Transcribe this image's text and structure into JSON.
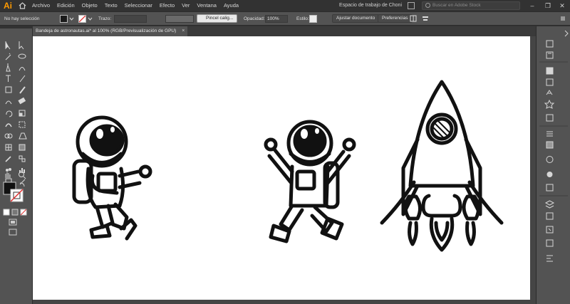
{
  "app": {
    "logo": "Ai",
    "menu": [
      "Archivo",
      "Edición",
      "Objeto",
      "Texto",
      "Seleccionar",
      "Efecto",
      "Ver",
      "Ventana",
      "Ayuda"
    ],
    "workspace_label": "Espacio de trabajo de Choni",
    "stock_search_placeholder": "Buscar en Adobe Stock",
    "window_controls": [
      "–",
      "❐",
      "✕"
    ]
  },
  "control_bar": {
    "selection_status": "No hay selección",
    "stroke_label": "Trazo:",
    "brush_label": "Pincel calig...",
    "opacity_label": "Opacidad:",
    "opacity_value": "100%",
    "style_label": "Estilo:",
    "document_setup_label": "Ajustar documento",
    "preferences_label": "Preferencias",
    "colors": {
      "fill": "#1a1a1a",
      "stroke": "#ffffff"
    }
  },
  "document": {
    "tab_title": "Bandeja de astronautas.ai* al 100% (RGB/Previsualización de GPU)",
    "tab_close": "×"
  },
  "artboard": {
    "objects": [
      "astronaut-floating",
      "astronaut-jumping",
      "rocket"
    ]
  },
  "icons": {
    "toolbar": [
      "selection-tool-icon",
      "direct-selection-tool-icon",
      "magic-wand-icon",
      "lasso-icon",
      "pen-tool-icon",
      "curvature-tool-icon",
      "type-tool-icon",
      "line-tool-icon",
      "rectangle-tool-icon",
      "paintbrush-icon",
      "shaper-tool-icon",
      "eraser-icon",
      "rotate-tool-icon",
      "scale-tool-icon",
      "warp-tool-icon",
      "free-transform-icon",
      "shape-builder-icon",
      "perspective-grid-icon",
      "mesh-tool-icon",
      "gradient-tool-icon",
      "eyedropper-icon",
      "blend-tool-icon",
      "symbol-sprayer-icon",
      "column-graph-icon",
      "artboard-tool-icon",
      "slice-tool-icon",
      "hand-tool-icon",
      "zoom-tool-icon"
    ],
    "right_panel": [
      "properties-icon",
      "libraries-icon",
      "color-icon",
      "color-guide-icon",
      "swatches-icon",
      "brushes-icon",
      "symbols-icon",
      "stroke-icon",
      "gradient-icon",
      "transparency-icon",
      "appearance-icon",
      "graphic-styles-icon",
      "layers-icon",
      "artboards-icon",
      "links-icon",
      "asset-export-icon",
      "align-icon"
    ]
  }
}
